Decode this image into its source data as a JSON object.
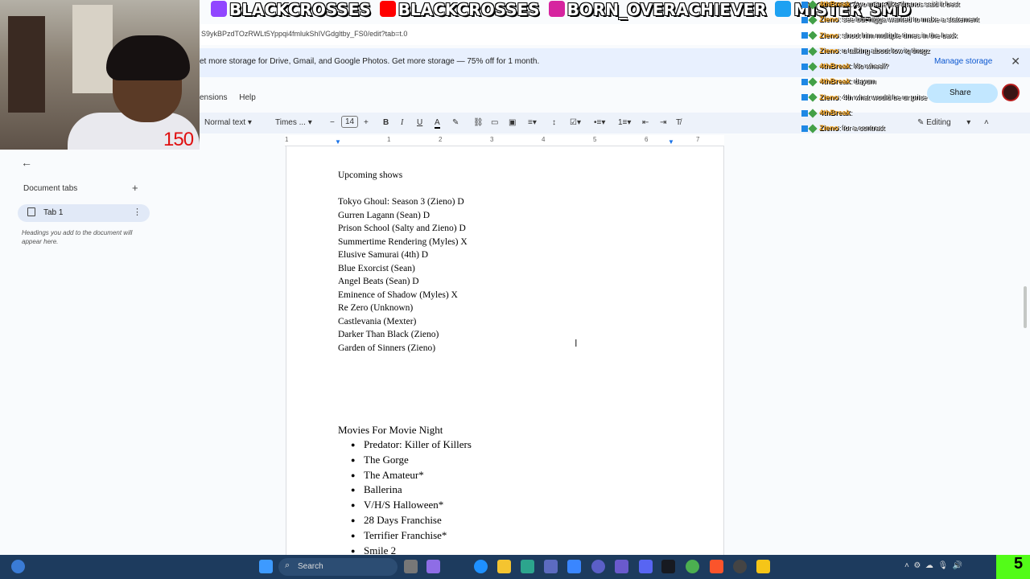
{
  "browser": {
    "url": "S9ykBPzdTOzRWLt5Yppqi4fmlukShIVGdgltby_FS0/edit?tab=t.0"
  },
  "banner": {
    "text": "et more storage for Drive, Gmail, and Google Photos. Get more storage — 75% off for 1 month.",
    "manage_label": "Manage storage"
  },
  "menu": {
    "items": [
      "ensions",
      "Help"
    ]
  },
  "share_label": "Share",
  "toolbar": {
    "style": "Normal text",
    "font": "Times ...",
    "size": "14",
    "mode": "Editing"
  },
  "ruler": {
    "ticks": [
      "1",
      "1",
      "2",
      "3",
      "4",
      "5",
      "6",
      "7"
    ]
  },
  "sidebar": {
    "title": "Document tabs",
    "tab_label": "Tab 1",
    "hint": "Headings you add to the document will appear here."
  },
  "document": {
    "shows_heading": "Upcoming shows",
    "shows": [
      "Tokyo Ghoul: Season 3 (Zieno) D",
      "Gurren Lagann (Sean) D",
      "Prison School (Salty and Zieno) D",
      "Summertime Rendering (Myles) X",
      "Elusive Samurai (4th) D",
      "Blue Exorcist (Sean)",
      "Angel Beats (Sean) D",
      "Eminence of Shadow (Myles) X",
      "Re Zero (Unknown)",
      "Castlevania (Mexter)",
      "Darker Than Black (Zieno)",
      "Garden of Sinners (Zieno)"
    ],
    "movies_heading": "Movies For Movie Night",
    "movies": [
      "Predator: Killer of Killers",
      "The Gorge",
      "The Amateur*",
      "Ballerina",
      "V/H/S Halloween*",
      "28 Days Franchise",
      "Terrifier Franchise*",
      "Smile 2"
    ]
  },
  "overlay": {
    "counter": "150",
    "social": [
      "BLACKCROSSES",
      "BLACKCROSSES",
      "BORN_OVERACHIEVER",
      "MISTER_SMD"
    ],
    "chat": [
      {
        "user": "4thBreak",
        "text": ": Ayo mane like thanos said it best",
        "color": "#f5a623"
      },
      {
        "user": "Zieno",
        "text": ": see but nigga wanted to make a statement",
        "color": "#f5a623"
      },
      {
        "user": "Zieno",
        "text": ": shoot him multiple times in the back",
        "color": "#f5a623"
      },
      {
        "user": "Zieno",
        "text": ": u talking about low iq thugz",
        "color": "#f5a623"
      },
      {
        "user": "4thBreak",
        "text": ": No wheel?",
        "color": "#f5a623"
      },
      {
        "user": "4thBreak",
        "text": ": dayum",
        "color": "#f5a623"
      },
      {
        "user": "Zieno",
        "text": ": 4th what would be ur price",
        "color": "#f5a623"
      },
      {
        "user": "4thBreak",
        "text": ":",
        "color": "#f5a623"
      },
      {
        "user": "Zieno",
        "text": ": for a contract",
        "color": "#f5a623"
      }
    ]
  },
  "taskbar": {
    "search_placeholder": "Search",
    "kick_badge": "5"
  }
}
